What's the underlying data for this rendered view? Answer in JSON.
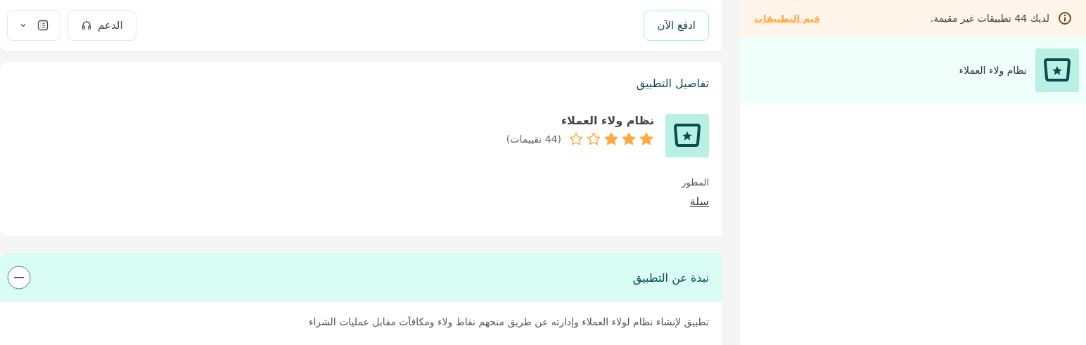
{
  "sidebar": {
    "notice": {
      "text": "لديك 44 تطبيقات غير مقيمة.",
      "link": "قيم التطبيقات"
    },
    "items": [
      {
        "label": "نظام ولاء العملاء",
        "selected": true
      }
    ]
  },
  "toolbar": {
    "pay_button": "ادفع الآن",
    "support_button": "الدعم"
  },
  "details": {
    "title": "تفاصيل التطبيق",
    "app_name": "نظام ولاء العملاء",
    "stars": 3,
    "ratings": "(44 تقييمات)",
    "developer_label": "المطور",
    "developer": "سلة"
  },
  "about": {
    "title": "نبذة عن التطبيق",
    "expanded": true,
    "text": "تطبيق لإنشاء نظام لولاء العملاء وإدارته عن طريق منحهم نقاط ولاء ومكافآت مقابل عمليات الشراء"
  }
}
